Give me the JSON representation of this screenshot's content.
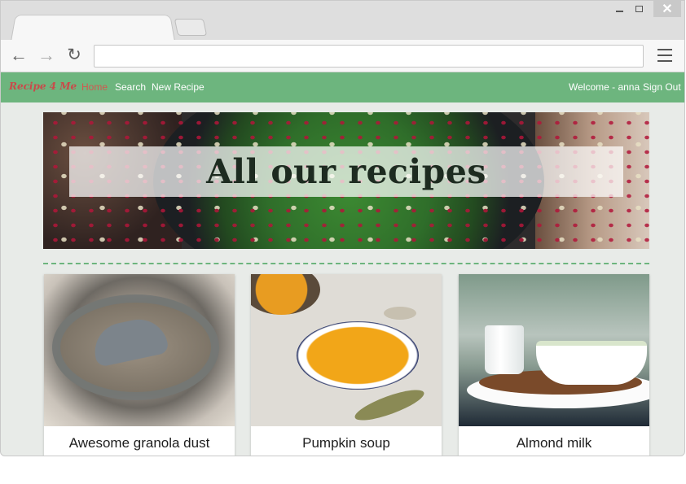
{
  "browser": {
    "address_value": "",
    "icons": [
      "back-arrow-icon",
      "forward-arrow-icon",
      "reload-icon",
      "menu-icon",
      "minimize-icon",
      "restore-icon",
      "close-icon"
    ]
  },
  "site": {
    "brand": "Recipe 4 Me",
    "nav": {
      "home": "Home",
      "search": "Search",
      "new_recipe": "New Recipe"
    },
    "welcome": "Welcome - anna",
    "sign_out": "Sign Out",
    "colors": {
      "navbar": "#6db57e",
      "brand": "#c94a4a",
      "active_link": "#d2574f"
    }
  },
  "hero": {
    "title": "All our recipes"
  },
  "recipes": [
    {
      "title": "Awesome granola dust"
    },
    {
      "title": "Pumpkin soup"
    },
    {
      "title": "Almond milk"
    }
  ]
}
